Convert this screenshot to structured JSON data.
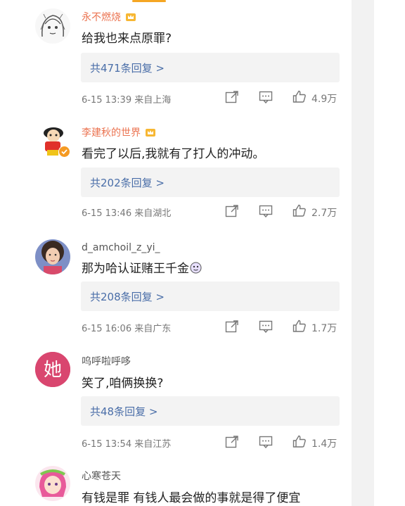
{
  "comments": [
    {
      "username": "永不燃烧",
      "text": "给我也来点原罪?",
      "replies": "共471条回复 >",
      "meta": "6-15 13:39  来自上海",
      "likes": "4.9万"
    },
    {
      "username": "李建秋的世界",
      "text": "看完了以后,我就有了打人的冲动。",
      "replies": "共202条回复 >",
      "meta": "6-15 13:46  来自湖北",
      "likes": "2.7万"
    },
    {
      "username": "d_amchoil_z_yi_",
      "text": "那为哈认证赌王千金",
      "replies": "共208条回复 >",
      "meta": "6-15 16:06  来自广东",
      "likes": "1.7万"
    },
    {
      "username": "呜呼啦呼哆",
      "text": "笑了,咱俩换换?",
      "replies": "共48条回复 >",
      "meta": "6-15 13:54  来自江苏",
      "likes": "1.4万"
    },
    {
      "username": "心寒苍天",
      "text": "有钱是罪  有钱人最会做的事就是得了便宜"
    }
  ],
  "avatar_badge_text": "她",
  "colors": {
    "username_highlight": "#eb7350",
    "reply_link": "#4a6ea8",
    "meta": "#777777",
    "reply_box": "#f3f3f3"
  }
}
